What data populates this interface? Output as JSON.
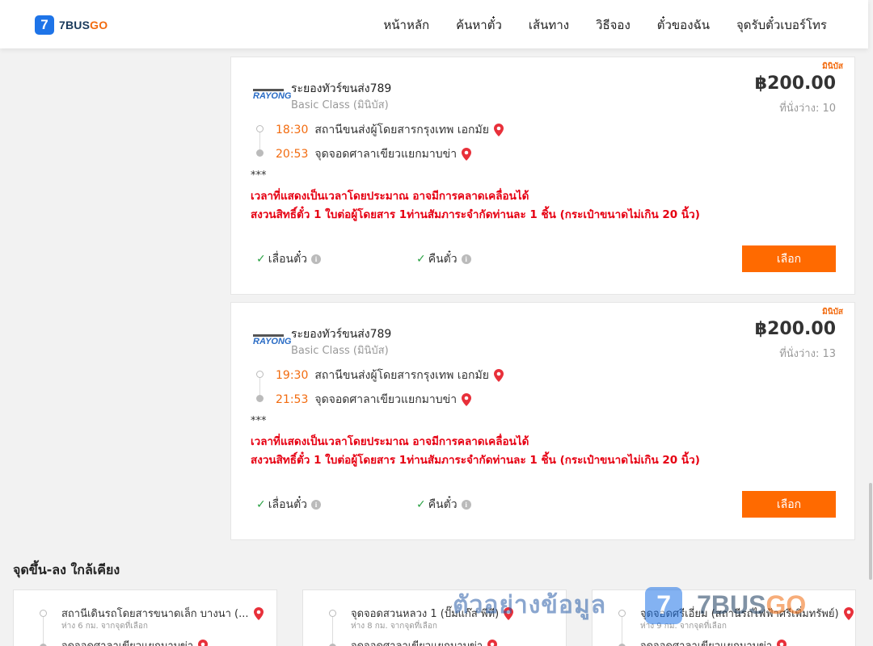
{
  "header": {
    "logo_mark": "7",
    "logo_text_main": "7BUS",
    "logo_text_accent": "GO",
    "nav": [
      "หน้าหลัก",
      "ค้นหาตั๋ว",
      "เส้นทาง",
      "วิธีจอง",
      "ตั๋วของฉัน",
      "จุดรับตั๋วเบอร์โทร"
    ]
  },
  "trips": [
    {
      "badge": "มินิบัส",
      "operator_logo_word": "RAYONG",
      "operator": "ระยองทัวร์ขนส่ง789",
      "bus_class": "Basic Class (มินิบัส)",
      "price": "฿200.00",
      "seats": "ที่นั่งว่าง: 10",
      "depart_time": "18:30",
      "depart_stop": "สถานีขนส่งผู้โดยสารกรุงเทพ เอกมัย",
      "arrive_time": "20:53",
      "arrive_stop": "จุดจอดศาลาเขียวแยกมาบข่า",
      "stars": "***",
      "note_line1": "เวลาที่แสดงเป็นเวลาโดยประมาณ อาจมีการคลาดเคลื่อนได้",
      "note_line2": "สงวนสิทธิ์ตั๋ว 1 ใบต่อผู้โดยสาร 1ท่านสัมภาระจำกัดท่านละ 1 ชิ้น (กระเป๋าขนาดไม่เกิน 20 นิ้ว)",
      "feature1": "เลื่อนตั๋ว",
      "feature2": "คืนตั๋ว",
      "select_label": "เลือก"
    },
    {
      "badge": "มินิบัส",
      "operator_logo_word": "RAYONG",
      "operator": "ระยองทัวร์ขนส่ง789",
      "bus_class": "Basic Class (มินิบัส)",
      "price": "฿200.00",
      "seats": "ที่นั่งว่าง: 13",
      "depart_time": "19:30",
      "depart_stop": "สถานีขนส่งผู้โดยสารกรุงเทพ เอกมัย",
      "arrive_time": "21:53",
      "arrive_stop": "จุดจอดศาลาเขียวแยกมาบข่า",
      "stars": "***",
      "note_line1": "เวลาที่แสดงเป็นเวลาโดยประมาณ อาจมีการคลาดเคลื่อนได้",
      "note_line2": "สงวนสิทธิ์ตั๋ว 1 ใบต่อผู้โดยสาร 1ท่านสัมภาระจำกัดท่านละ 1 ชิ้น (กระเป๋าขนาดไม่เกิน 20 นิ้ว)",
      "feature1": "เลื่อนตั๋ว",
      "feature2": "คืนตั๋ว",
      "select_label": "เลือก"
    }
  ],
  "nearby": {
    "title": "จุดขึ้น-ลง ใกล้เคียง",
    "cards": [
      {
        "from": "สถานีเดินรถโดยสารขนาดเล็ก บางนา (...",
        "distance": "ห่าง 6 กม. จากจุดที่เลือก",
        "to": "จุดจอดศาลาเขียวแยกมาบข่า"
      },
      {
        "from": "จุดจอดสวนหลวง 1 (ปั๊มแก๊ส พีที)",
        "distance": "ห่าง 8 กม. จากจุดที่เลือก",
        "to": "จุดจอดศาลาเขียวแยกมาบข่า"
      },
      {
        "from": "จุดจอดศรีเอี่ยม (สถานีรถไฟฟ้าศรีเพิ่มทรัพย์)",
        "distance": "ห่าง 9 กม. จากจุดที่เลือก",
        "to": "จุดจอดศาลาเขียวแยกมาบข่า"
      }
    ]
  },
  "watermark": {
    "text": "ตัวอย่างข้อมูล",
    "logo_mark": "7",
    "brand_main": "7BUS",
    "brand_accent": "GO"
  },
  "colors": {
    "accent": "#ff6a00",
    "brand_blue": "#1e74e8",
    "warning_red": "#e60012",
    "check_green": "#2ba244"
  }
}
